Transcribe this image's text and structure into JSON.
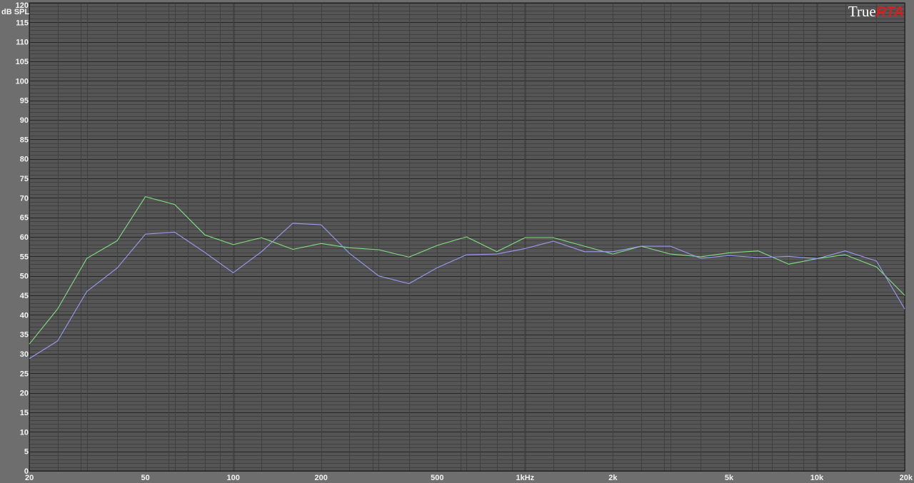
{
  "app": {
    "logo_main": "True",
    "logo_accent": "RTA"
  },
  "colors": {
    "background": "#6e6e6e",
    "plot_background": "#555555",
    "minor_grid": "#404040",
    "decade_grid": "#262626",
    "border": "#1a1a1a",
    "logo_accent": "#d81e1e"
  },
  "chart_data": {
    "type": "line",
    "x_scale": "log",
    "xlim": [
      20,
      20000
    ],
    "ylim": [
      0,
      120
    ],
    "ylabel": "dB SPL",
    "grid": true,
    "x_ticks": [
      {
        "value": 20,
        "label": "20"
      },
      {
        "value": 50,
        "label": "50"
      },
      {
        "value": 100,
        "label": "100"
      },
      {
        "value": 200,
        "label": "200"
      },
      {
        "value": 500,
        "label": "500"
      },
      {
        "value": 1000,
        "label": "1kHz"
      },
      {
        "value": 2000,
        "label": "2k"
      },
      {
        "value": 5000,
        "label": "5k"
      },
      {
        "value": 10000,
        "label": "10k"
      },
      {
        "value": 20000,
        "label": "20k"
      }
    ],
    "y_ticks": [
      {
        "value": 0,
        "label": "0"
      },
      {
        "value": 5,
        "label": "5"
      },
      {
        "value": 10,
        "label": "10"
      },
      {
        "value": 15,
        "label": "15"
      },
      {
        "value": 20,
        "label": "20"
      },
      {
        "value": 25,
        "label": "25"
      },
      {
        "value": 30,
        "label": "30"
      },
      {
        "value": 35,
        "label": "35"
      },
      {
        "value": 40,
        "label": "40"
      },
      {
        "value": 45,
        "label": "45"
      },
      {
        "value": 50,
        "label": "50"
      },
      {
        "value": 55,
        "label": "55"
      },
      {
        "value": 60,
        "label": "60"
      },
      {
        "value": 65,
        "label": "65"
      },
      {
        "value": 70,
        "label": "70"
      },
      {
        "value": 75,
        "label": "75"
      },
      {
        "value": 80,
        "label": "80"
      },
      {
        "value": 85,
        "label": "85"
      },
      {
        "value": 90,
        "label": "90"
      },
      {
        "value": 95,
        "label": "95"
      },
      {
        "value": 100,
        "label": "100"
      },
      {
        "value": 105,
        "label": "105"
      },
      {
        "value": 110,
        "label": "110"
      },
      {
        "value": 115,
        "label": "115"
      },
      {
        "value": 120,
        "label": "120"
      }
    ],
    "x": [
      20,
      25,
      31.5,
      40,
      50,
      63,
      80,
      100,
      125,
      160,
      200,
      250,
      315,
      400,
      500,
      630,
      800,
      1000,
      1250,
      1600,
      2000,
      2500,
      3150,
      4000,
      5000,
      6300,
      8000,
      10000,
      12500,
      16000,
      20000
    ],
    "series": [
      {
        "color": "#7ee07e",
        "values": [
          32.5,
          41.5,
          54.5,
          59,
          70.3,
          68.3,
          60.5,
          58,
          59.8,
          56.8,
          58.3,
          57.2,
          56.7,
          54.8,
          57.8,
          60,
          56.2,
          59.8,
          59.8,
          57.6,
          55.6,
          57.6,
          55.6,
          54.9,
          55.9,
          56.4,
          53,
          54.4,
          55.4,
          52.3,
          45
        ]
      },
      {
        "color": "#9a9af2",
        "values": [
          28.8,
          33.3,
          46,
          52,
          60.7,
          61.2,
          56,
          50.8,
          56.2,
          63.5,
          63.1,
          55.8,
          50,
          48,
          52.1,
          55.4,
          55.6,
          57,
          58.9,
          56.2,
          56.2,
          57.6,
          57.6,
          54.5,
          55.2,
          54.7,
          55,
          54.4,
          56.4,
          53.8,
          41.5
        ]
      }
    ]
  }
}
